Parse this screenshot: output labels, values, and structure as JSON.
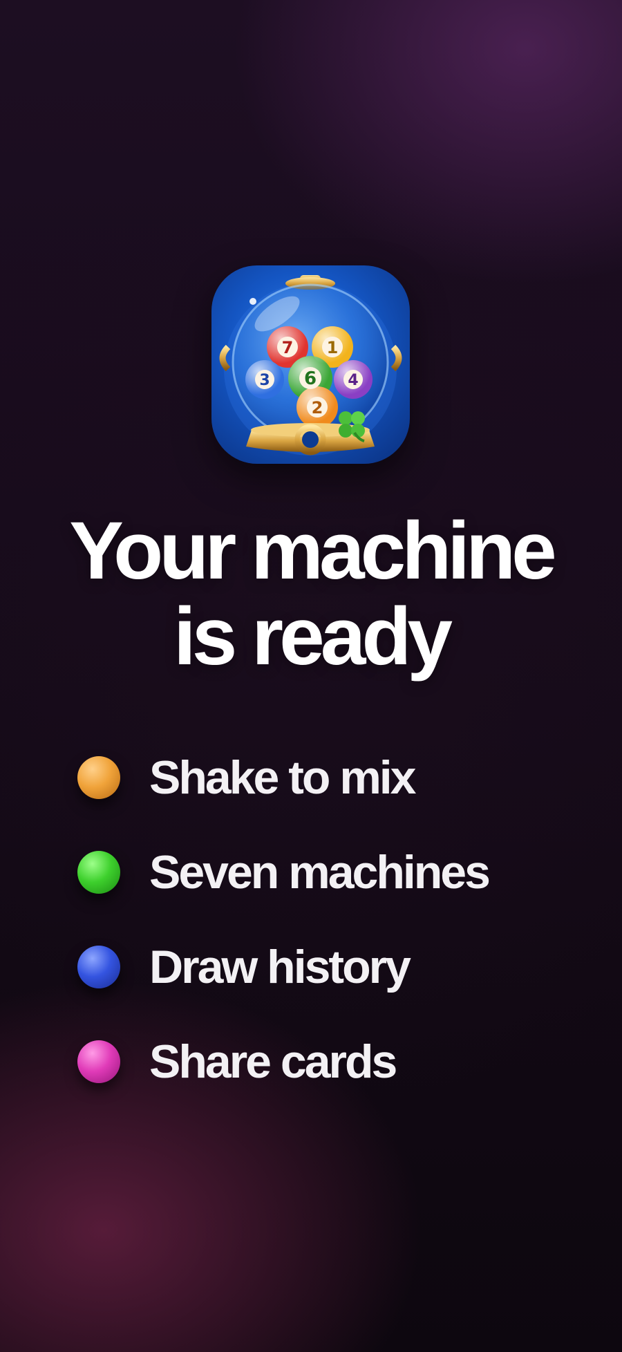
{
  "app_icon": {
    "name": "gumball-lottery-machine-icon",
    "balls": [
      {
        "number": "7",
        "color": "#e0342f"
      },
      {
        "number": "1",
        "color": "#f2b31c"
      },
      {
        "number": "3",
        "color": "#2f6fe0"
      },
      {
        "number": "6",
        "color": "#3aa636"
      },
      {
        "number": "4",
        "color": "#8a3fc4"
      },
      {
        "number": "2",
        "color": "#f08a1c"
      }
    ],
    "decoration": "four-leaf-clover-icon"
  },
  "headline": {
    "line1": "Your machine",
    "line2": "is ready"
  },
  "features": [
    {
      "label": "Shake to mix",
      "ball_color": "#f0a33a",
      "icon": "orange-ball-icon"
    },
    {
      "label": "Seven machines",
      "ball_color": "#3ed02d",
      "icon": "green-ball-icon"
    },
    {
      "label": "Draw history",
      "ball_color": "#3454e0",
      "icon": "blue-ball-icon"
    },
    {
      "label": "Share cards",
      "ball_color": "#e03bb8",
      "icon": "pink-ball-icon"
    }
  ],
  "colors": {
    "background_top": "#1d0e22",
    "background_bottom": "#0d070f",
    "text": "#ffffff"
  }
}
